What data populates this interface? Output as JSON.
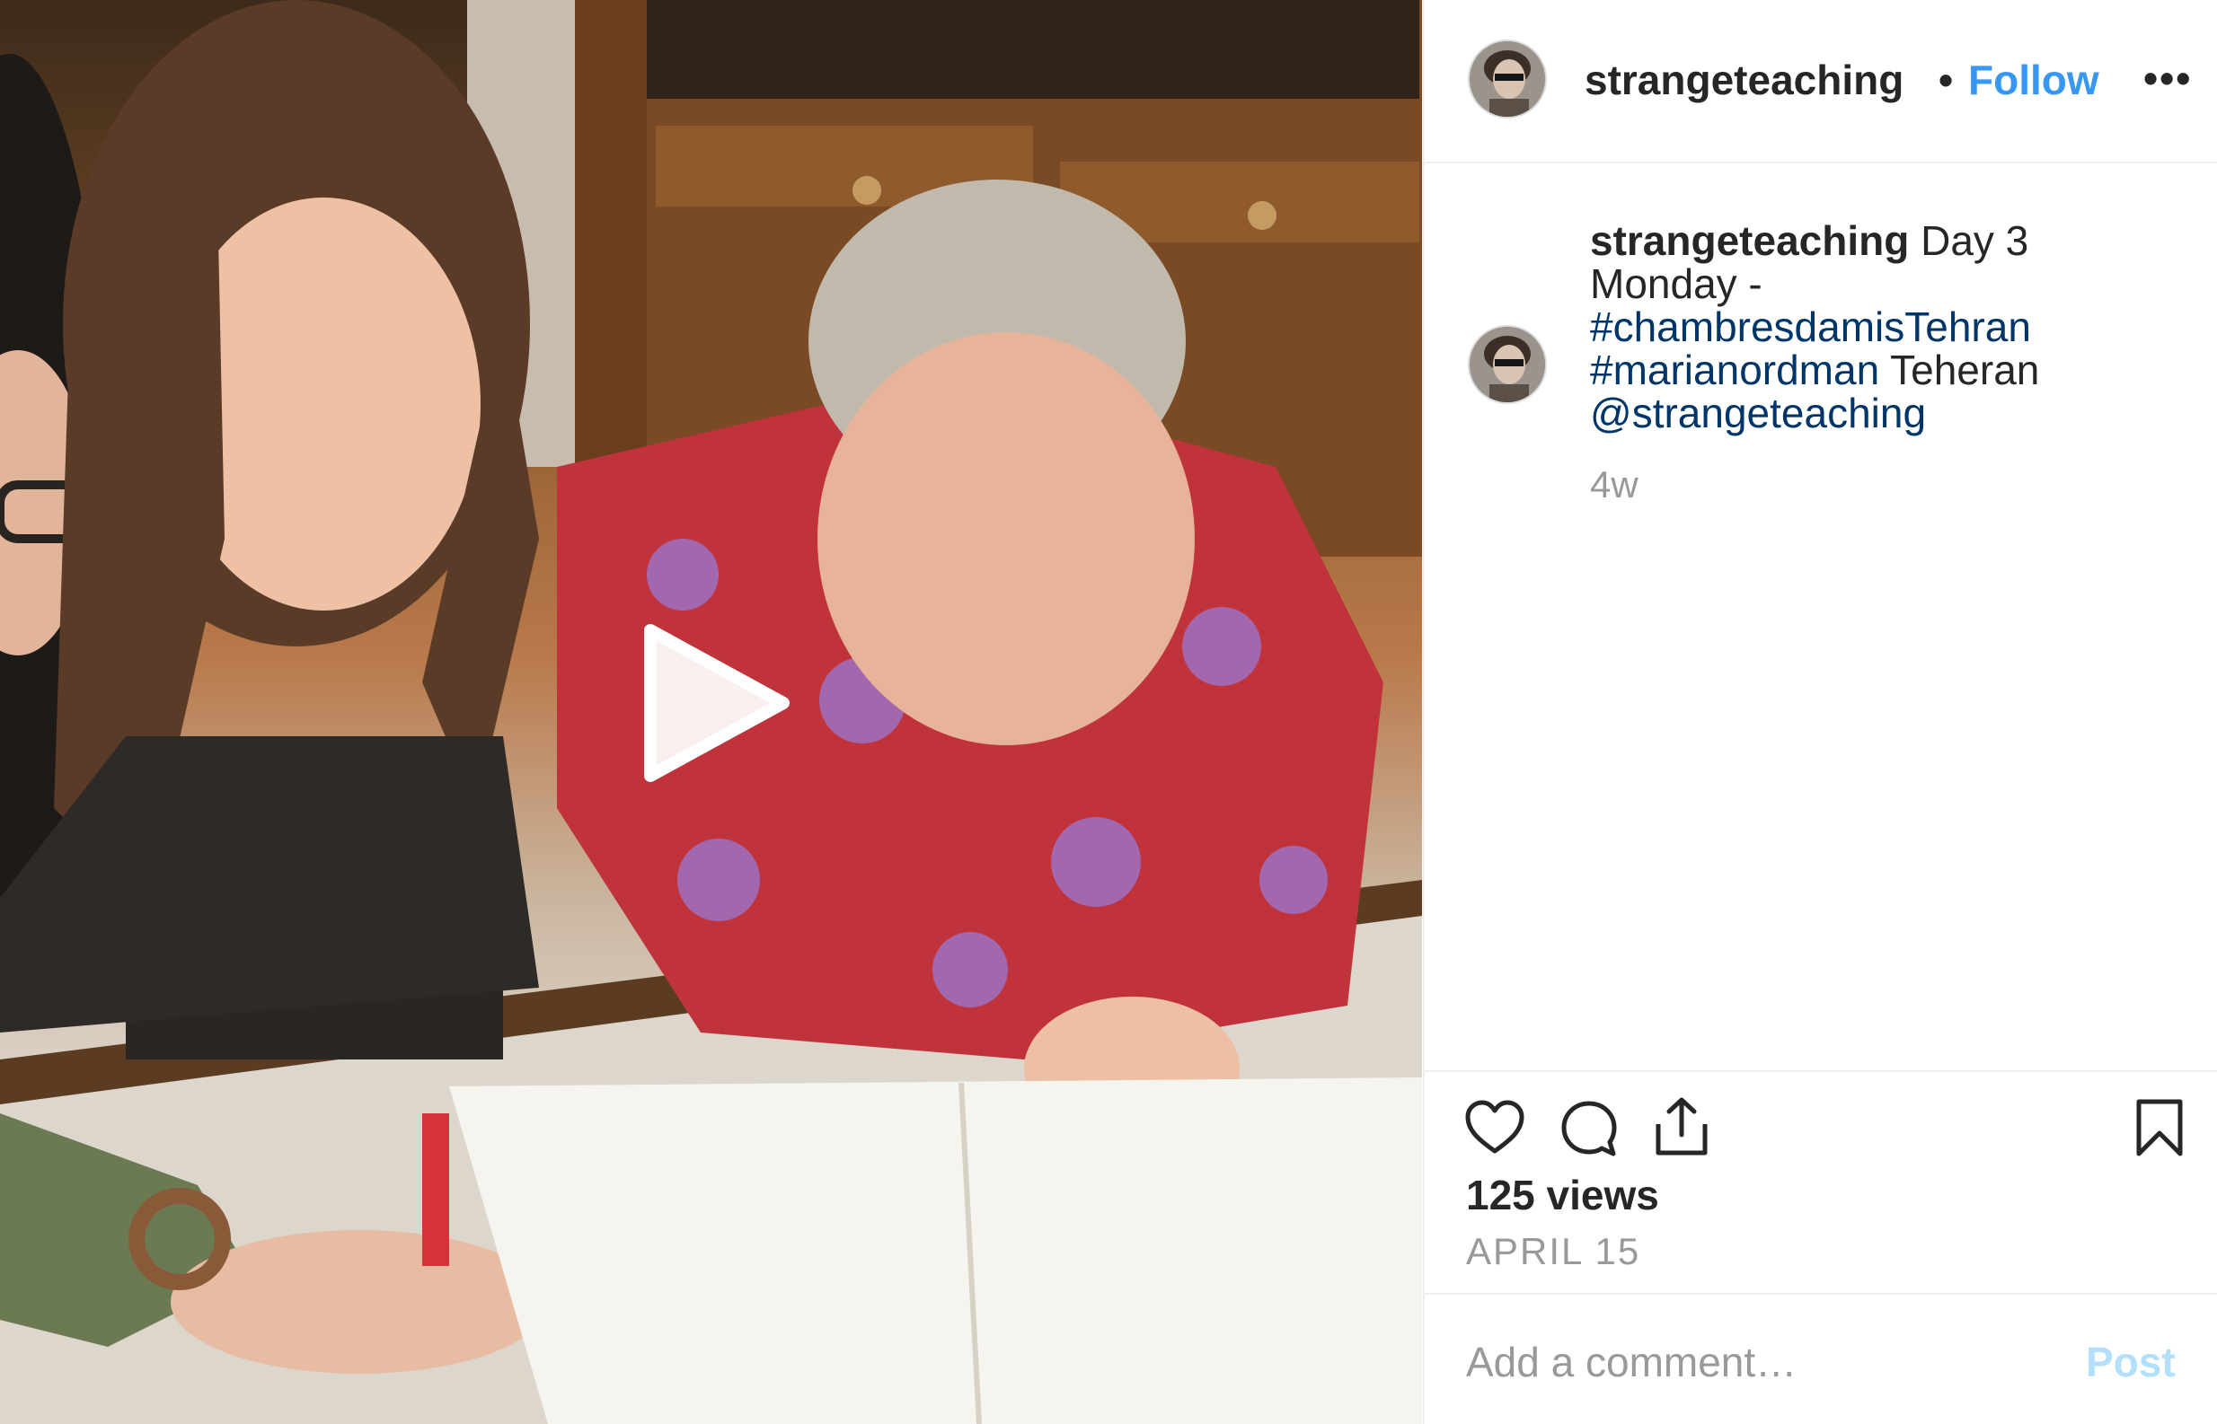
{
  "post": {
    "username": "strangeteaching",
    "separator": "•",
    "follow_label": "Follow",
    "more_label": "•••",
    "caption": {
      "username": "strangeteaching",
      "text_1": " Day 3 Monday - ",
      "hashtag_1": "#chambresdamisTehran",
      "hashtag_2": "#marianordman",
      "text_2": " Teheran ",
      "mention": "@strangeteaching"
    },
    "time_ago": "4w",
    "views": "125 views",
    "date": "APRIL 15",
    "comment_placeholder": "Add a comment…",
    "post_label": "Post"
  },
  "icons": {
    "play": "play-icon",
    "like": "heart-icon",
    "comment": "comment-icon",
    "share": "share-icon",
    "save": "bookmark-icon",
    "more": "more-icon"
  },
  "colors": {
    "link": "#003569",
    "follow": "#3897f0",
    "muted": "#999999",
    "post_disabled": "#b2dffc",
    "border": "#efefef"
  }
}
